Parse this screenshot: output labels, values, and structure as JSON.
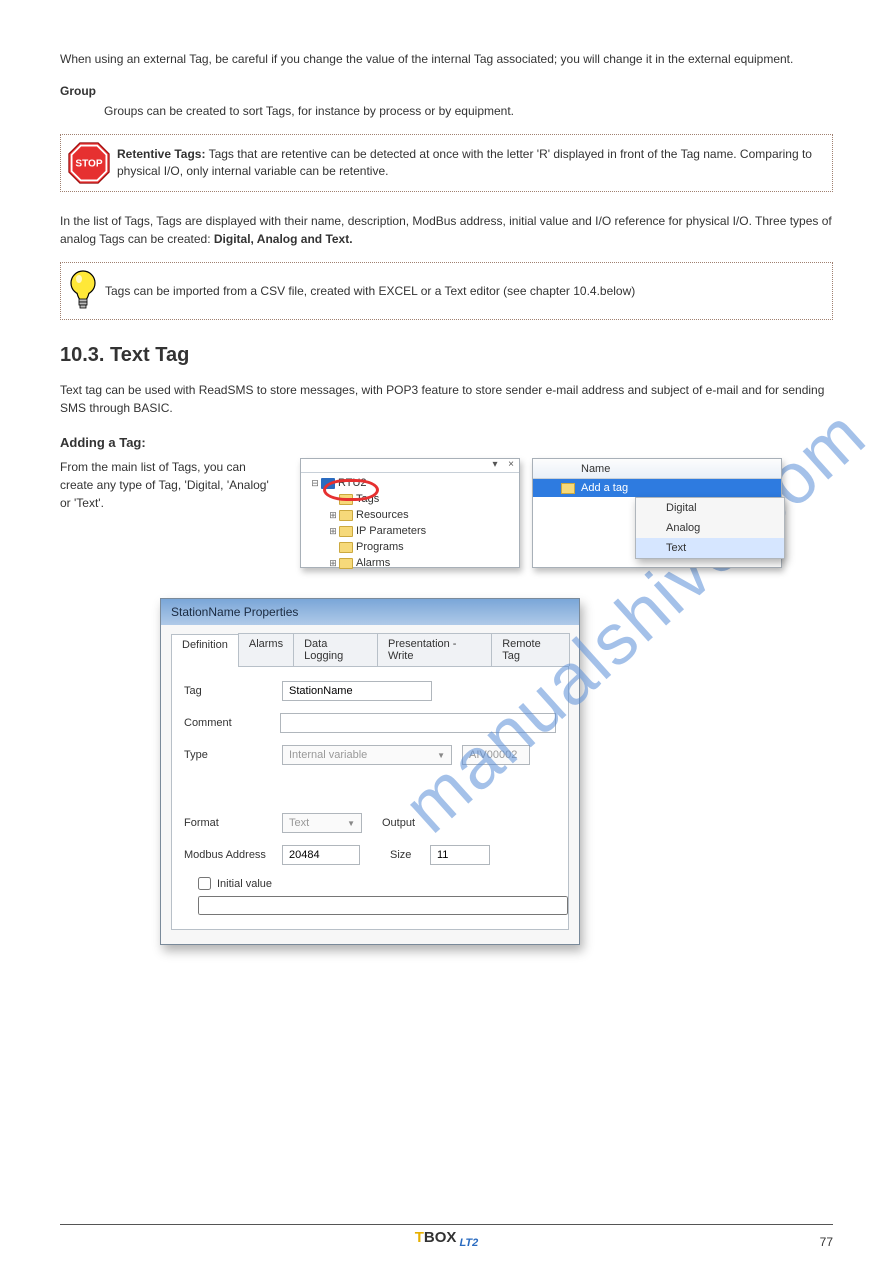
{
  "intro_para": "When using an external Tag, be careful if you change the value of the internal Tag associated; you will change it in the external equipment.",
  "group_heading": "Group",
  "group_para": "Groups can be created to sort Tags, for instance by process or by equipment.",
  "stop_callout": {
    "title": "Retentive Tags:",
    "text": " Tags that are retentive can be detected at once with the letter 'R' displayed in front of the Tag name. Comparing to physical I/O, only internal variable can be retentive."
  },
  "tag_list_intro": "In the list of Tags, Tags are displayed with their name, description, ModBus address, initial value and I/O reference for physical I/O. Three types of analog Tags can be created: ",
  "tag_list_suffix": "Digital, Analog and Text.",
  "tip_callout": "Tags can be imported from a CSV file, created with EXCEL or a Text editor (see chapter 10.4.below)",
  "section_title": "10.3. Text Tag",
  "text_tag_para": "Text tag can be used with ReadSMS to store messages, with POP3 feature to store sender e-mail address and subject of e-mail and for sending SMS through BASIC.",
  "sub_title": "Adding a Tag:",
  "add_tag_desc": "From the main list of Tags, you can create any type of Tag, 'Digital, 'Analog' or 'Text'.",
  "tree": {
    "root": "RTU2",
    "items": [
      "Tags",
      "Resources",
      "IP Parameters",
      "Programs",
      "Alarms"
    ]
  },
  "list_panel": {
    "header": "Name",
    "row": "Add a tag"
  },
  "context_menu": [
    "Digital",
    "Analog",
    "Text"
  ],
  "dialog": {
    "title": "StationName Properties",
    "tabs": [
      "Definition",
      "Alarms",
      "Data Logging",
      "Presentation - Write",
      "Remote Tag"
    ],
    "fields": {
      "tag_label": "Tag",
      "tag_value": "StationName",
      "comment_label": "Comment",
      "comment_value": "",
      "type_label": "Type",
      "type_value": "Internal variable",
      "type_code": "AIV00002",
      "format_label": "Format",
      "format_value": "Text",
      "output_label": "Output",
      "modbus_label": "Modbus Address",
      "modbus_value": "20484",
      "size_label": "Size",
      "size_value": "11",
      "initial_label": "Initial value",
      "initial_value": ""
    }
  },
  "watermark": "manualshive.com",
  "footer": {
    "brand_t": "T",
    "brand_box": "BOX",
    "lt2": " LT2",
    "page": "77"
  }
}
